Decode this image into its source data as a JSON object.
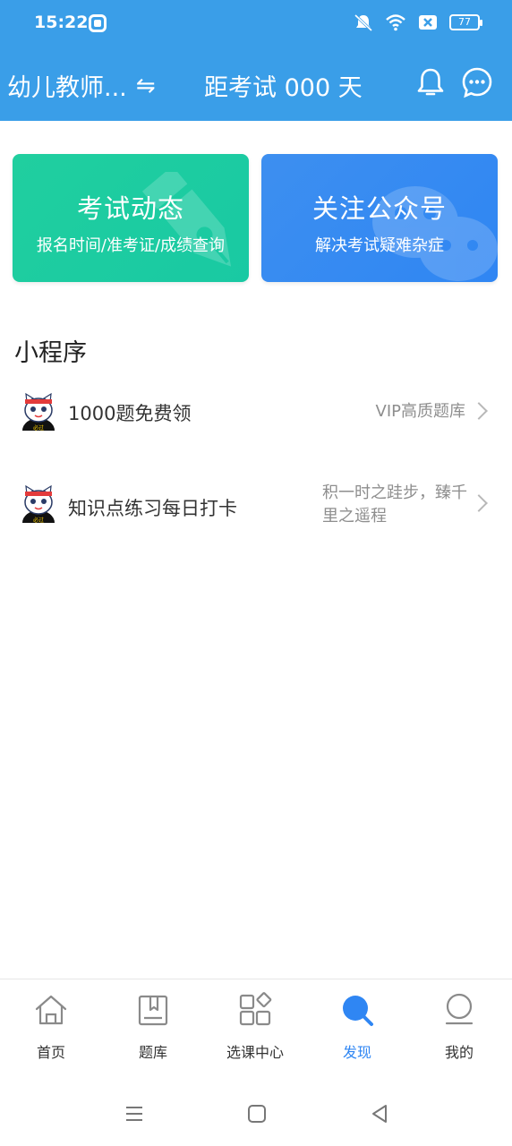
{
  "status_bar": {
    "time": "15:22",
    "battery": "77",
    "icons": [
      "app-icon",
      "mute-icon",
      "wifi-icon",
      "sim-off-icon",
      "battery-icon"
    ]
  },
  "header": {
    "exam_select_label": "幼儿教师...",
    "swap_icon": "⇋",
    "countdown": "距考试 000 天",
    "icons": [
      "bell-icon",
      "chat-icon"
    ],
    "background_color": "#3a9ee8"
  },
  "cards": [
    {
      "title": "考试动态",
      "subtitle": "报名时间/准考证/成绩查询",
      "icon": "pen-icon",
      "color": "#1ccca1"
    },
    {
      "title": "关注公众号",
      "subtitle": "解决考试疑难杂症",
      "icon": "wechat-icon",
      "color": "#3389f2"
    }
  ],
  "mini_programs": {
    "title": "小程序",
    "items": [
      {
        "title": "1000题免费领",
        "desc": "VIP高质题库",
        "avatar": "cat-mascot-icon",
        "badge": "必过"
      },
      {
        "title": "知识点练习每日打卡",
        "desc": "积一时之跬步，臻千里之遥程",
        "avatar": "cat-mascot-icon",
        "badge": "必过"
      }
    ]
  },
  "tabbar": {
    "active_color": "#2f86f3",
    "tabs": [
      {
        "label": "首页",
        "icon": "home-icon",
        "active": false
      },
      {
        "label": "题库",
        "icon": "book-icon",
        "active": false
      },
      {
        "label": "选课中心",
        "icon": "grid-icon",
        "active": false
      },
      {
        "label": "发现",
        "icon": "search-icon",
        "active": true
      },
      {
        "label": "我的",
        "icon": "profile-icon",
        "active": false
      }
    ]
  },
  "system_nav": {
    "icons": [
      "menu-icon",
      "home-square-icon",
      "back-icon"
    ]
  }
}
